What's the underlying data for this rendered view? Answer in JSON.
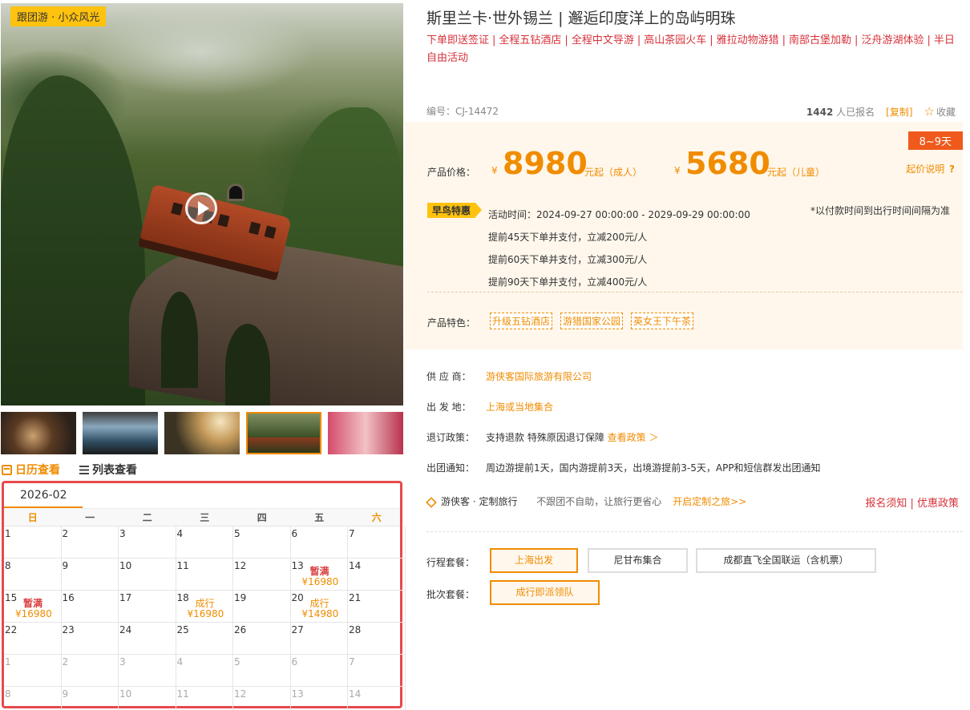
{
  "hero": {
    "tag": "跟团游 · 小众风光"
  },
  "view_tabs": {
    "calendar": "日历查看",
    "list": "列表查看"
  },
  "calendar": {
    "month": "2026-02",
    "weekdays": [
      "日",
      "一",
      "二",
      "三",
      "四",
      "五",
      "六"
    ],
    "rows": [
      [
        {
          "d": "1"
        },
        {
          "d": "2"
        },
        {
          "d": "3"
        },
        {
          "d": "4"
        },
        {
          "d": "5"
        },
        {
          "d": "6"
        },
        {
          "d": "7"
        }
      ],
      [
        {
          "d": "8"
        },
        {
          "d": "9"
        },
        {
          "d": "10"
        },
        {
          "d": "11"
        },
        {
          "d": "12"
        },
        {
          "d": "13",
          "status": "暂满",
          "price": "¥16980"
        },
        {
          "d": "14"
        }
      ],
      [
        {
          "d": "15",
          "status": "暂满",
          "price": "¥16980"
        },
        {
          "d": "16"
        },
        {
          "d": "17"
        },
        {
          "d": "18",
          "status": "成行",
          "price": "¥16980",
          "go": true
        },
        {
          "d": "19"
        },
        {
          "d": "20",
          "status": "成行",
          "price": "¥14980",
          "go": true
        },
        {
          "d": "21"
        }
      ],
      [
        {
          "d": "22"
        },
        {
          "d": "23"
        },
        {
          "d": "24"
        },
        {
          "d": "25"
        },
        {
          "d": "26"
        },
        {
          "d": "27"
        },
        {
          "d": "28"
        }
      ],
      [
        {
          "d": "1",
          "mute": true
        },
        {
          "d": "2",
          "mute": true
        },
        {
          "d": "3",
          "mute": true
        },
        {
          "d": "4",
          "mute": true
        },
        {
          "d": "5",
          "mute": true
        },
        {
          "d": "6",
          "mute": true
        },
        {
          "d": "7",
          "mute": true
        }
      ],
      [
        {
          "d": "8",
          "mute": true
        },
        {
          "d": "9",
          "mute": true
        },
        {
          "d": "10",
          "mute": true
        },
        {
          "d": "11",
          "mute": true
        },
        {
          "d": "12",
          "mute": true
        },
        {
          "d": "13",
          "mute": true
        },
        {
          "d": "14",
          "mute": true
        }
      ]
    ]
  },
  "product": {
    "title": "斯里兰卡·世外锡兰 | 邂逅印度洋上的岛屿明珠",
    "tags": [
      "下单即送签证",
      "全程五钻酒店",
      "全程中文导游",
      "高山茶园火车",
      "雅拉动物游猎",
      "南部古堡加勒",
      "泛舟游湖体验",
      "半日自由活动"
    ],
    "code": "编号：CJ-14472",
    "signups_count": "1442",
    "signups_label": "人已报名",
    "copy": "[复制]",
    "favorite": "收藏"
  },
  "price": {
    "days": "8~9天",
    "label": "产品价格：",
    "currency": "¥",
    "adult": "8980",
    "adult_unit": "元起（成人）",
    "child": "5680",
    "child_unit": "元起（儿童）",
    "note": "起价说明"
  },
  "promo": {
    "badge": "早鸟特惠",
    "time": "活动时间：2024-09-27 00:00:00 - 2029-09-29 00:00:00",
    "note": "*以付款时间到出行时间间隔为准",
    "rules": [
      "提前45天下单并支付，立减200元/人",
      "提前60天下单并支付，立减300元/人",
      "提前90天下单并支付，立减400元/人"
    ]
  },
  "features": {
    "label": "产品特色：",
    "tags": [
      "升级五钻酒店",
      "游猎国家公园",
      "英女王下午茶"
    ]
  },
  "info": {
    "supplier_label": "供 应 商：",
    "supplier": "游侠客国际旅游有限公司",
    "departure_label": "出 发 地：",
    "departure": "上海或当地集合",
    "refund_label": "退订政策：",
    "refund": "支持退款 特殊原因退订保障",
    "refund_link": "查看政策 ＞",
    "notice_label": "出团通知：",
    "notice": "周边游提前1天，国内游提前3天，出境游提前3-5天，APP和短信群发出团通知"
  },
  "custom": {
    "brand": "游侠客 · 定制旅行",
    "slogan": "不跟团不自助，让旅行更省心",
    "link": "开启定制之旅>>",
    "right_links": [
      "报名须知",
      "优惠政策"
    ]
  },
  "packages": {
    "route_label": "行程套餐：",
    "routes": [
      "上海出发",
      "尼甘布集合",
      "成都直飞全国联运（含机票）"
    ],
    "batch_label": "批次套餐：",
    "batches": [
      "成行即派领队"
    ]
  }
}
